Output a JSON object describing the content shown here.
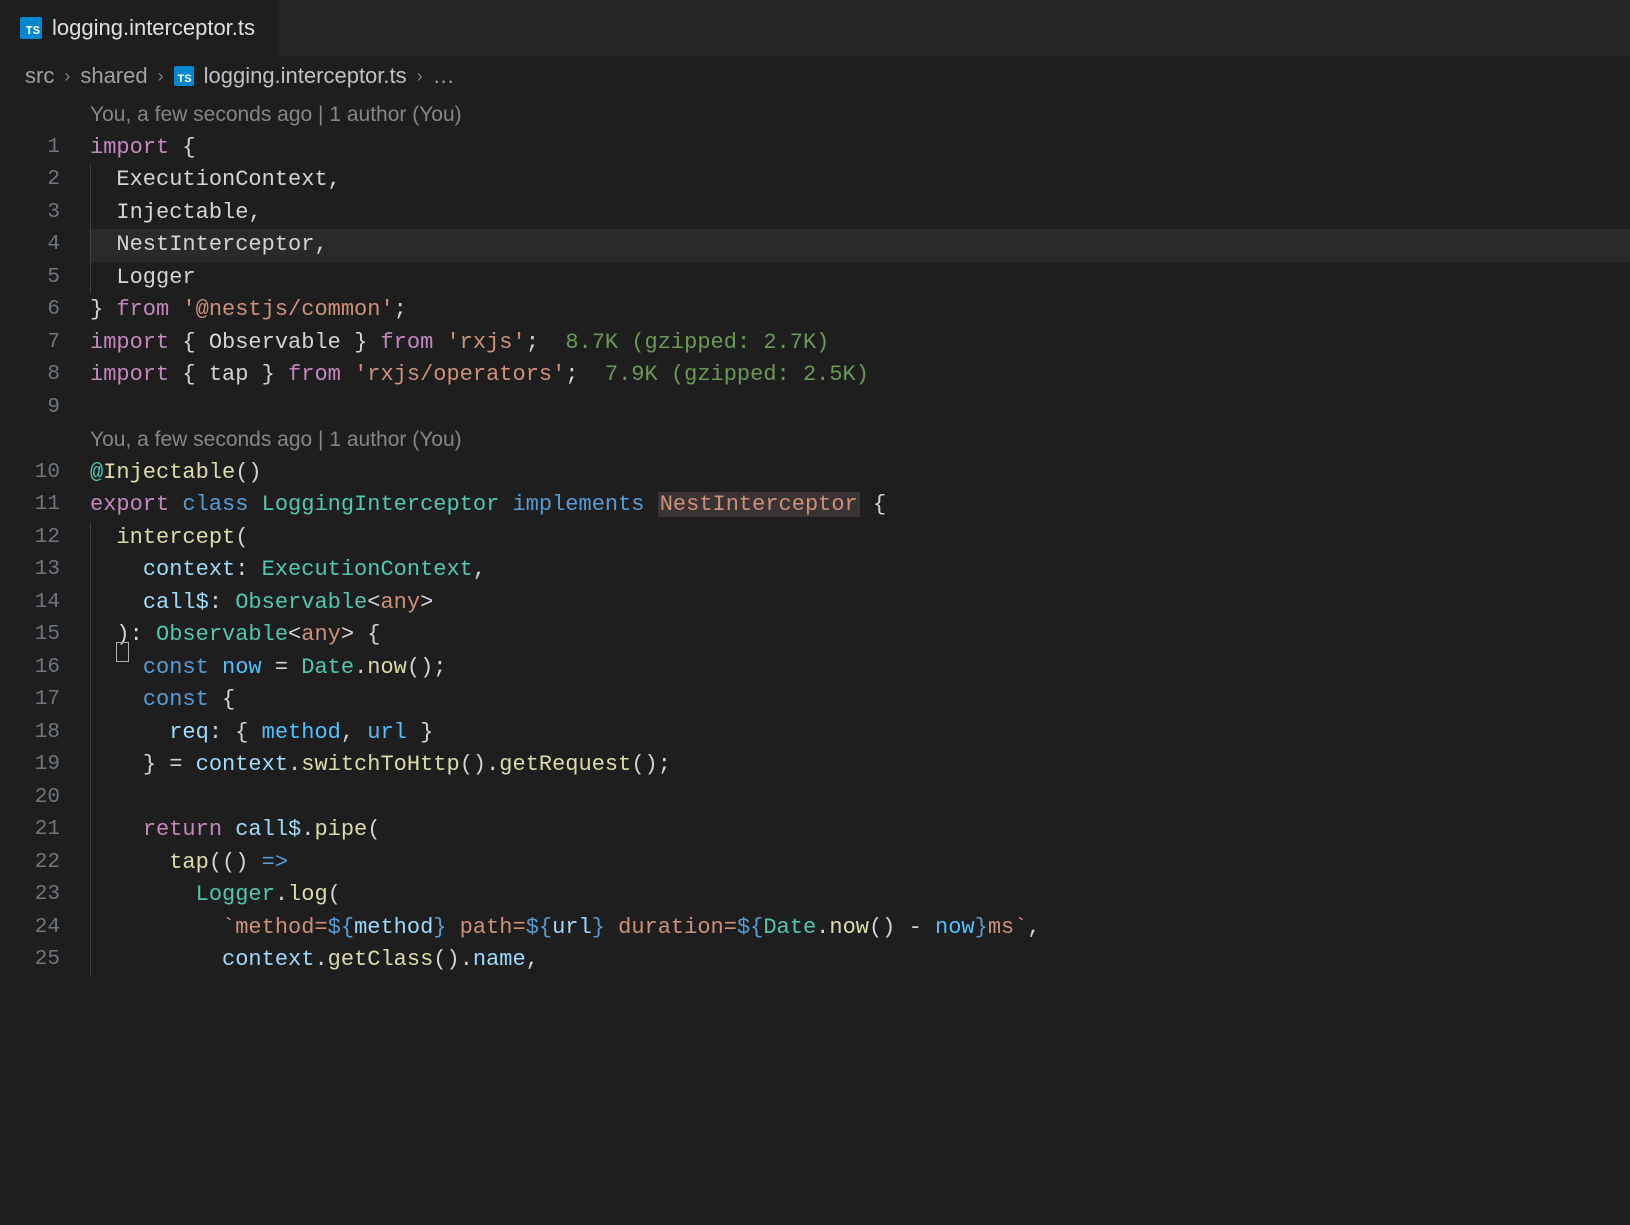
{
  "tab": {
    "icon_text": "TS",
    "title": "logging.interceptor.ts"
  },
  "breadcrumb": {
    "parts": [
      "src",
      "shared"
    ],
    "icon_text": "TS",
    "file": "logging.interceptor.ts",
    "ellipsis": "…"
  },
  "codelens": {
    "line0": "You, a few seconds ago | 1 author (You)",
    "line1": "You, a few seconds ago | 1 author (You)"
  },
  "code": {
    "l1": {
      "import": "import",
      "brace": "{"
    },
    "l2": {
      "i1": "ExecutionContext",
      "c": ","
    },
    "l3": {
      "i1": "Injectable",
      "c": ","
    },
    "l4": {
      "i1": "NestInterceptor",
      "c": ","
    },
    "l5": {
      "i1": "Logger"
    },
    "l6": {
      "brace": "}",
      "from": "from",
      "str": "'@nestjs/common'",
      "sc": ";"
    },
    "l7": {
      "import": "import",
      "b1": "{",
      "i1": "Observable",
      "b2": "}",
      "from": "from",
      "str": "'rxjs'",
      "sc": ";",
      "hint": "8.7K (gzipped: 2.7K)"
    },
    "l8": {
      "import": "import",
      "b1": "{",
      "i1": "tap",
      "b2": "}",
      "from": "from",
      "str": "'rxjs/operators'",
      "sc": ";",
      "hint": "7.9K (gzipped: 2.5K)"
    },
    "l10": {
      "at": "@",
      "dec": "Injectable",
      "p": "()"
    },
    "l11": {
      "export": "export",
      "class": "class",
      "name": "LoggingInterceptor",
      "implements": "implements",
      "iface": "NestInterceptor",
      "b": "{"
    },
    "l12": {
      "fn": "intercept",
      "p": "("
    },
    "l13": {
      "param": "context",
      "colon": ":",
      "type": "ExecutionContext",
      "c": ","
    },
    "l14": {
      "param": "call$",
      "colon": ":",
      "type": "Observable",
      "lt": "<",
      "gen": "any",
      "gt": ">"
    },
    "l15": {
      "p1": ")",
      "colon": ":",
      "type": "Observable",
      "lt": "<",
      "gen": "any",
      "gt": ">",
      "b": "{"
    },
    "l16": {
      "const": "const",
      "var": "now",
      "eq": "=",
      "obj": "Date",
      "dot": ".",
      "fn": "now",
      "p": "()",
      "sc": ";"
    },
    "l17": {
      "const": "const",
      "b": "{"
    },
    "l18": {
      "var": "req",
      "colon": ":",
      "b1": "{",
      "v1": "method",
      "c": ",",
      "v2": "url",
      "b2": "}"
    },
    "l19": {
      "b": "}",
      "eq": "=",
      "var": "context",
      "d1": ".",
      "f1": "switchToHttp",
      "p1": "()",
      "d2": ".",
      "f2": "getRequest",
      "p2": "()",
      "sc": ";"
    },
    "l21": {
      "return": "return",
      "var": "call$",
      "dot": ".",
      "fn": "pipe",
      "p": "("
    },
    "l22": {
      "fn": "tap",
      "p1": "(",
      "p2": "()",
      "arrow": "=>"
    },
    "l23": {
      "obj": "Logger",
      "dot": ".",
      "fn": "log",
      "p": "("
    },
    "l24": {
      "t1": "`method=",
      "e1o": "${",
      "e1v": "method",
      "e1c": "}",
      "t2": " path=",
      "e2o": "${",
      "e2v": "url",
      "e2c": "}",
      "t3": " duration=",
      "e3o": "${",
      "e3d": "Date",
      "e3dot": ".",
      "e3f": "now",
      "e3p": "()",
      "e3m": " - ",
      "e3n": "now",
      "e3c": "}",
      "t4": "ms`",
      "comma": ","
    },
    "l25": {
      "var": "context",
      "d": ".",
      "f1": "getClass",
      "p1": "()",
      "d2": ".",
      "prop": "name",
      "c": ","
    }
  },
  "line_numbers": [
    "1",
    "2",
    "3",
    "4",
    "5",
    "6",
    "7",
    "8",
    "9",
    "10",
    "11",
    "12",
    "13",
    "14",
    "15",
    "16",
    "17",
    "18",
    "19",
    "20",
    "21",
    "22",
    "23",
    "24",
    "25"
  ]
}
